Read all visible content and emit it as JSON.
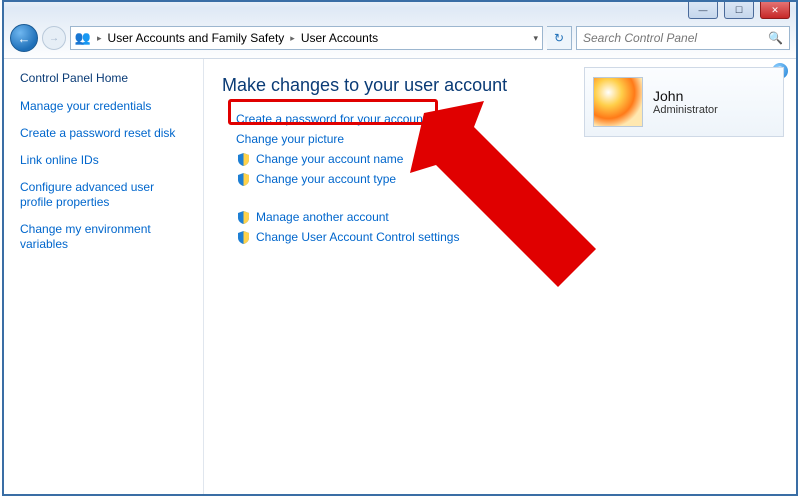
{
  "window_controls": {
    "min": "—",
    "max": "☐",
    "close": "✕"
  },
  "breadcrumb": {
    "root": "User Accounts and Family Safety",
    "page": "User Accounts"
  },
  "search": {
    "placeholder": "Search Control Panel"
  },
  "sidebar": {
    "heading": "Control Panel Home",
    "links": [
      "Manage your credentials",
      "Create a password reset disk",
      "Link online IDs",
      "Configure advanced user profile properties",
      "Change my environment variables"
    ]
  },
  "content": {
    "heading": "Make changes to your user account",
    "options": [
      {
        "label": "Create a password for your account",
        "shield": false,
        "highlighted": true
      },
      {
        "label": "Change your picture",
        "shield": false
      },
      {
        "label": "Change your account name",
        "shield": true
      },
      {
        "label": "Change your account type",
        "shield": true
      }
    ],
    "secondary": [
      {
        "label": "Manage another account",
        "shield": true
      },
      {
        "label": "Change User Account Control settings",
        "shield": true
      }
    ]
  },
  "user_tile": {
    "name": "John",
    "role": "Administrator"
  }
}
